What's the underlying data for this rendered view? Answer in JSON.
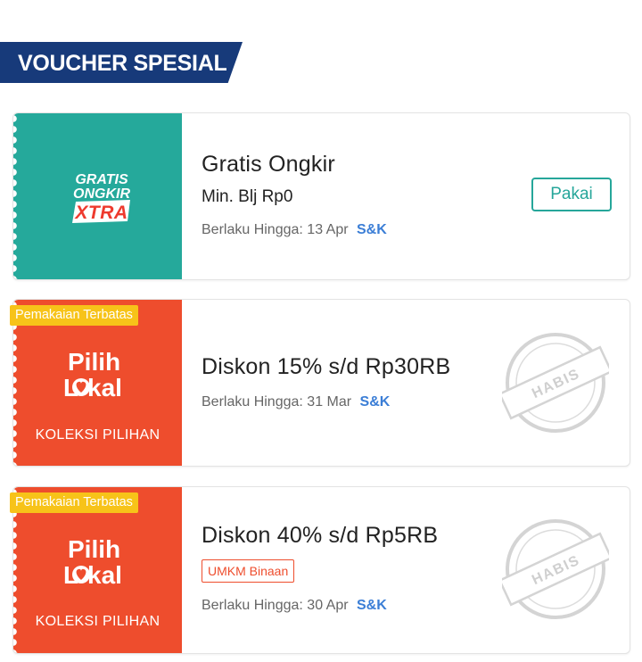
{
  "section": {
    "title": "VOUCHER SPESIAL"
  },
  "vouchers": [
    {
      "logo": [
        "GRATIS",
        "ONGKIR",
        "XTRA"
      ],
      "title": "Gratis Ongkir",
      "min_purchase": "Min. Blj Rp0",
      "validity": "Berlaku Hingga: 13 Apr",
      "terms": "S&K",
      "action": "Pakai",
      "color": "#25a99b"
    },
    {
      "badge": "Pemakaian Terbatas",
      "logo": [
        "Pilih",
        "Lokal"
      ],
      "collection": "KOLEKSI PILIHAN",
      "title": "Diskon 15% s/d Rp30RB",
      "validity": "Berlaku Hingga: 31 Mar",
      "terms": "S&K",
      "stamp": "HABIS",
      "color": "#ee4d2d"
    },
    {
      "badge": "Pemakaian Terbatas",
      "logo": [
        "Pilih",
        "Lokal"
      ],
      "collection": "KOLEKSI PILIHAN",
      "title": "Diskon 40% s/d Rp5RB",
      "tag": "UMKM Binaan",
      "validity": "Berlaku Hingga: 30 Apr",
      "terms": "S&K",
      "stamp": "HABIS",
      "color": "#ee4d2d"
    }
  ]
}
